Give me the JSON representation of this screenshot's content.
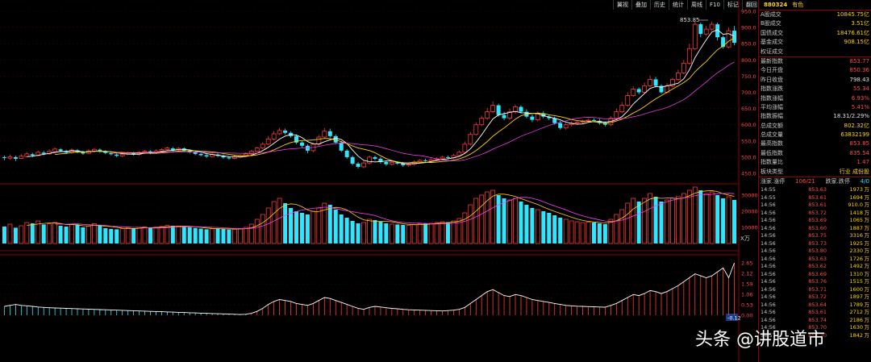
{
  "toolbar": [
    "翼视",
    "叠加",
    "历史",
    "统计",
    "周线",
    "F10",
    "标记",
    "翻回"
  ],
  "header": {
    "code": "880324",
    "name": "有色"
  },
  "right_panel": {
    "rows": [
      {
        "label": "A股成交",
        "value": "10845.75亿",
        "cls": "v-yel"
      },
      {
        "label": "B股成交",
        "value": "3.51亿",
        "cls": "v-yel"
      },
      {
        "label": "国债成交",
        "value": "18476.61亿",
        "cls": "v-yel"
      },
      {
        "label": "基金成交",
        "value": "908.15亿",
        "cls": "v-yel"
      },
      {
        "label": "权证成交",
        "value": "",
        "cls": "v-yel"
      },
      {
        "label": "最新指数",
        "value": "853.77",
        "cls": "v-red"
      },
      {
        "label": "今日开盘",
        "value": "850.36",
        "cls": "v-red"
      },
      {
        "label": "昨日收盘",
        "value": "798.43",
        "cls": "v-white"
      },
      {
        "label": "指数涨跌",
        "value": "55.34",
        "cls": "v-red"
      },
      {
        "label": "指数涨幅",
        "value": "6.93%",
        "cls": "v-red"
      },
      {
        "label": "平均涨幅",
        "value": "5.41%",
        "cls": "v-red"
      },
      {
        "label": "指数振幅",
        "value": "18.31/2.29%",
        "cls": "v-white"
      },
      {
        "label": "总成交额",
        "value": "802.32亿",
        "cls": "v-yel"
      },
      {
        "label": "总成交量",
        "value": "63832199",
        "cls": "v-yel"
      },
      {
        "label": "最高指数",
        "value": "853.85",
        "cls": "v-red"
      },
      {
        "label": "最低指数",
        "value": "835.54",
        "cls": "v-red"
      },
      {
        "label": "指数量比",
        "value": "1.47",
        "cls": "v-red"
      },
      {
        "label": "板块类型",
        "value": "行业 成份股",
        "cls": "v-yel"
      }
    ],
    "updown": {
      "label": "涨家.涨停",
      "value": "106/21",
      "label2": "跌家.跌停",
      "value2": "4/0"
    },
    "ticks": [
      {
        "t": "14:55",
        "p": "853.63",
        "v": "1973",
        "u": "万"
      },
      {
        "t": "14:55",
        "p": "853.61",
        "v": "1694",
        "u": "万"
      },
      {
        "t": "14:56",
        "p": "853.61",
        "v": "910.0",
        "u": "万"
      },
      {
        "t": "14:56",
        "p": "853.72",
        "v": "1418",
        "u": "万"
      },
      {
        "t": "14:56",
        "p": "853.69",
        "v": "1065",
        "u": "万"
      },
      {
        "t": "14:56",
        "p": "853.60",
        "v": "1887",
        "u": "万"
      },
      {
        "t": "14:56",
        "p": "853.75",
        "v": "3316",
        "u": "万"
      },
      {
        "t": "14:56",
        "p": "853.73",
        "v": "1925",
        "u": "万"
      },
      {
        "t": "14:56",
        "p": "853.80",
        "v": "2330",
        "u": "万"
      },
      {
        "t": "14:56",
        "p": "853.63",
        "v": "1726",
        "u": "万"
      },
      {
        "t": "14:56",
        "p": "853.62",
        "v": "1492",
        "u": "万"
      },
      {
        "t": "14:56",
        "p": "853.69",
        "v": "1310",
        "u": "万"
      },
      {
        "t": "14:56",
        "p": "853.76",
        "v": "1515",
        "u": "万"
      },
      {
        "t": "14:56",
        "p": "853.71",
        "v": "1600",
        "u": "万"
      },
      {
        "t": "14:56",
        "p": "853.72",
        "v": "1897",
        "u": "万"
      },
      {
        "t": "14:56",
        "p": "853.64",
        "v": "1789",
        "u": "万"
      },
      {
        "t": "14:56",
        "p": "853.61",
        "v": "2712",
        "u": "万"
      },
      {
        "t": "14:56",
        "p": "853.74",
        "v": "2186",
        "u": "万"
      },
      {
        "t": "14:56",
        "p": "853.70",
        "v": "1630",
        "u": "万"
      },
      {
        "t": "14:57",
        "p": "853.70",
        "v": "1842",
        "u": "万"
      }
    ]
  },
  "watermark": "头条 @讲股道市",
  "vol_unit": "X万",
  "chart_data": {
    "type": "candlestick",
    "price_ylim": [
      450,
      950
    ],
    "price_ticks": [
      "950.0",
      "900.0",
      "850.0",
      "800.0",
      "750.0",
      "700.0",
      "650.0",
      "600.0",
      "550.0",
      "500.0",
      "450.0"
    ],
    "peak_label": "853.85",
    "volume_ticks": [
      "30000",
      "20000",
      "10000"
    ],
    "volume_ylim": [
      0,
      35000
    ],
    "indicator_ticks": [
      "2.65",
      "2.12",
      "1.59",
      "1.06",
      "0.53",
      "0.00",
      "-0.12"
    ],
    "indicator_ylim": [
      -0.12,
      2.9
    ],
    "candles": [
      [
        500,
        498,
        505,
        490
      ],
      [
        497,
        501,
        508,
        492
      ],
      [
        500,
        495,
        504,
        488
      ],
      [
        496,
        503,
        509,
        494
      ],
      [
        502,
        510,
        516,
        500
      ],
      [
        509,
        505,
        513,
        500
      ],
      [
        505,
        515,
        520,
        503
      ],
      [
        514,
        510,
        519,
        506
      ],
      [
        510,
        518,
        524,
        508
      ],
      [
        517,
        525,
        530,
        514
      ],
      [
        524,
        519,
        528,
        515
      ],
      [
        519,
        514,
        523,
        510
      ],
      [
        514,
        522,
        527,
        511
      ],
      [
        521,
        516,
        525,
        512
      ],
      [
        516,
        511,
        520,
        507
      ],
      [
        512,
        519,
        524,
        509
      ],
      [
        518,
        524,
        528,
        515
      ],
      [
        523,
        518,
        527,
        514
      ],
      [
        518,
        513,
        521,
        509
      ],
      [
        513,
        509,
        517,
        505
      ],
      [
        508,
        504,
        513,
        500
      ],
      [
        504,
        509,
        514,
        501
      ],
      [
        509,
        513,
        517,
        506
      ],
      [
        513,
        508,
        516,
        505
      ],
      [
        508,
        514,
        519,
        505
      ],
      [
        513,
        518,
        522,
        510
      ],
      [
        518,
        512,
        521,
        509
      ],
      [
        513,
        519,
        524,
        510
      ],
      [
        519,
        523,
        527,
        515
      ],
      [
        523,
        528,
        532,
        520
      ],
      [
        527,
        522,
        531,
        518
      ],
      [
        522,
        527,
        531,
        519
      ],
      [
        527,
        520,
        530,
        516
      ],
      [
        520,
        515,
        524,
        511
      ],
      [
        515,
        510,
        519,
        506
      ],
      [
        510,
        506,
        514,
        502
      ],
      [
        506,
        502,
        510,
        498
      ],
      [
        502,
        508,
        512,
        499
      ],
      [
        508,
        504,
        512,
        500
      ],
      [
        504,
        499,
        508,
        495
      ],
      [
        499,
        496,
        503,
        492
      ],
      [
        496,
        500,
        505,
        493
      ],
      [
        500,
        505,
        509,
        497
      ],
      [
        505,
        510,
        514,
        502
      ],
      [
        510,
        518,
        522,
        507
      ],
      [
        518,
        528,
        532,
        515
      ],
      [
        528,
        540,
        546,
        525
      ],
      [
        540,
        556,
        565,
        537
      ],
      [
        556,
        572,
        580,
        552
      ],
      [
        572,
        582,
        590,
        568
      ],
      [
        582,
        575,
        588,
        570
      ],
      [
        575,
        565,
        580,
        560
      ],
      [
        565,
        545,
        570,
        540
      ],
      [
        545,
        535,
        550,
        530
      ],
      [
        535,
        520,
        540,
        512
      ],
      [
        520,
        540,
        545,
        515
      ],
      [
        540,
        562,
        568,
        536
      ],
      [
        562,
        580,
        590,
        558
      ],
      [
        580,
        565,
        588,
        560
      ],
      [
        565,
        545,
        570,
        540
      ],
      [
        545,
        520,
        550,
        515
      ],
      [
        520,
        500,
        525,
        495
      ],
      [
        500,
        480,
        505,
        475
      ],
      [
        480,
        470,
        485,
        465
      ],
      [
        470,
        482,
        488,
        466
      ],
      [
        482,
        500,
        505,
        478
      ],
      [
        500,
        495,
        505,
        490
      ],
      [
        495,
        485,
        500,
        480
      ],
      [
        485,
        478,
        490,
        473
      ],
      [
        478,
        484,
        490,
        474
      ],
      [
        484,
        480,
        488,
        476
      ],
      [
        480,
        475,
        485,
        470
      ],
      [
        475,
        478,
        482,
        470
      ],
      [
        478,
        485,
        490,
        474
      ],
      [
        485,
        490,
        494,
        481
      ],
      [
        490,
        488,
        495,
        484
      ],
      [
        488,
        492,
        496,
        484
      ],
      [
        492,
        495,
        500,
        488
      ],
      [
        495,
        500,
        504,
        491
      ],
      [
        500,
        498,
        505,
        494
      ],
      [
        498,
        505,
        510,
        494
      ],
      [
        505,
        515,
        520,
        502
      ],
      [
        515,
        540,
        548,
        512
      ],
      [
        540,
        570,
        578,
        536
      ],
      [
        570,
        600,
        608,
        566
      ],
      [
        600,
        620,
        628,
        596
      ],
      [
        620,
        640,
        652,
        615
      ],
      [
        640,
        660,
        672,
        635
      ],
      [
        660,
        630,
        665,
        625
      ],
      [
        630,
        620,
        640,
        614
      ],
      [
        620,
        640,
        650,
        615
      ],
      [
        640,
        655,
        662,
        634
      ],
      [
        655,
        640,
        660,
        634
      ],
      [
        640,
        625,
        648,
        620
      ],
      [
        625,
        615,
        632,
        608
      ],
      [
        615,
        635,
        640,
        610
      ],
      [
        635,
        625,
        642,
        620
      ],
      [
        625,
        620,
        630,
        614
      ],
      [
        620,
        605,
        625,
        600
      ],
      [
        605,
        590,
        612,
        585
      ],
      [
        590,
        600,
        605,
        585
      ],
      [
        600,
        605,
        610,
        595
      ],
      [
        605,
        608,
        612,
        600
      ],
      [
        608,
        610,
        615,
        603
      ],
      [
        610,
        614,
        618,
        606
      ],
      [
        614,
        612,
        620,
        608
      ],
      [
        612,
        605,
        618,
        600
      ],
      [
        605,
        600,
        610,
        595
      ],
      [
        600,
        620,
        626,
        596
      ],
      [
        620,
        640,
        650,
        615
      ],
      [
        640,
        660,
        670,
        636
      ],
      [
        660,
        690,
        700,
        656
      ],
      [
        690,
        710,
        718,
        686
      ],
      [
        710,
        700,
        715,
        694
      ],
      [
        700,
        720,
        730,
        696
      ],
      [
        720,
        740,
        752,
        716
      ],
      [
        740,
        720,
        748,
        715
      ],
      [
        720,
        700,
        725,
        695
      ],
      [
        700,
        720,
        728,
        696
      ],
      [
        720,
        740,
        745,
        715
      ],
      [
        740,
        760,
        770,
        735
      ],
      [
        760,
        790,
        800,
        755
      ],
      [
        790,
        835,
        850,
        785
      ],
      [
        835,
        910,
        920,
        830
      ],
      [
        910,
        880,
        915,
        870
      ],
      [
        880,
        895,
        905,
        875
      ],
      [
        895,
        910,
        918,
        890
      ],
      [
        910,
        870,
        915,
        860
      ],
      [
        870,
        840,
        875,
        835
      ],
      [
        840,
        890,
        900,
        836
      ],
      [
        890,
        853,
        905,
        845
      ]
    ],
    "volumes": [
      10500,
      12000,
      9800,
      11000,
      13000,
      12500,
      14000,
      11800,
      12200,
      13000,
      11000,
      10500,
      12000,
      11500,
      10000,
      10800,
      12300,
      11000,
      9500,
      9000,
      8800,
      9200,
      9800,
      9500,
      10000,
      10300,
      9700,
      10100,
      10500,
      11200,
      11000,
      10700,
      10500,
      10000,
      9600,
      9200,
      8800,
      9100,
      9400,
      9000,
      8600,
      8800,
      9300,
      10000,
      12000,
      15000,
      18000,
      22000,
      26000,
      28000,
      25000,
      22000,
      20000,
      19000,
      18000,
      20000,
      22000,
      25000,
      24000,
      21000,
      18000,
      16000,
      14000,
      12500,
      13000,
      15000,
      14500,
      13500,
      12500,
      12000,
      11800,
      11500,
      11200,
      11700,
      12300,
      12600,
      12500,
      13000,
      13500,
      13200,
      14000,
      15500,
      19000,
      24000,
      28000,
      30000,
      32000,
      33000,
      30000,
      28000,
      27000,
      28000,
      26000,
      24000,
      22000,
      21000,
      20000,
      19000,
      17500,
      16000,
      15000,
      14000,
      13500,
      13000,
      13200,
      13000,
      12500,
      12000,
      15000,
      18000,
      21000,
      25000,
      28000,
      26000,
      28000,
      31000,
      29000,
      26000,
      27000,
      28000,
      29000,
      31000,
      33000,
      35000,
      33000,
      31000,
      32000,
      30000,
      28000,
      29000,
      27000
    ],
    "indicator": [
      0.45,
      0.5,
      0.55,
      0.5,
      0.48,
      0.45,
      0.42,
      0.4,
      0.38,
      0.37,
      0.36,
      0.35,
      0.34,
      0.33,
      0.32,
      0.31,
      0.3,
      0.29,
      0.28,
      0.27,
      0.26,
      0.25,
      0.24,
      0.23,
      0.22,
      0.21,
      0.2,
      0.19,
      0.18,
      0.17,
      0.16,
      0.15,
      0.14,
      0.13,
      0.12,
      0.11,
      0.1,
      0.09,
      0.08,
      0.07,
      0.06,
      0.05,
      0.04,
      0.05,
      0.1,
      0.2,
      0.35,
      0.55,
      0.7,
      0.8,
      0.75,
      0.7,
      0.6,
      0.55,
      0.5,
      0.6,
      0.75,
      0.9,
      0.85,
      0.75,
      0.65,
      0.55,
      0.45,
      0.35,
      0.3,
      0.4,
      0.45,
      0.42,
      0.38,
      0.35,
      0.33,
      0.3,
      0.28,
      0.27,
      0.26,
      0.25,
      0.24,
      0.23,
      0.22,
      0.24,
      0.26,
      0.3,
      0.4,
      0.6,
      0.8,
      1.0,
      1.2,
      1.3,
      1.15,
      1.0,
      0.95,
      1.05,
      1.0,
      0.9,
      0.8,
      0.75,
      0.7,
      0.65,
      0.6,
      0.55,
      0.5,
      0.48,
      0.46,
      0.45,
      0.44,
      0.43,
      0.42,
      0.41,
      0.5,
      0.6,
      0.75,
      0.9,
      1.05,
      1.0,
      1.1,
      1.25,
      1.2,
      1.1,
      1.2,
      1.35,
      1.5,
      1.7,
      1.9,
      2.1,
      2.0,
      1.9,
      2.0,
      2.2,
      2.4,
      1.9,
      2.65
    ]
  }
}
